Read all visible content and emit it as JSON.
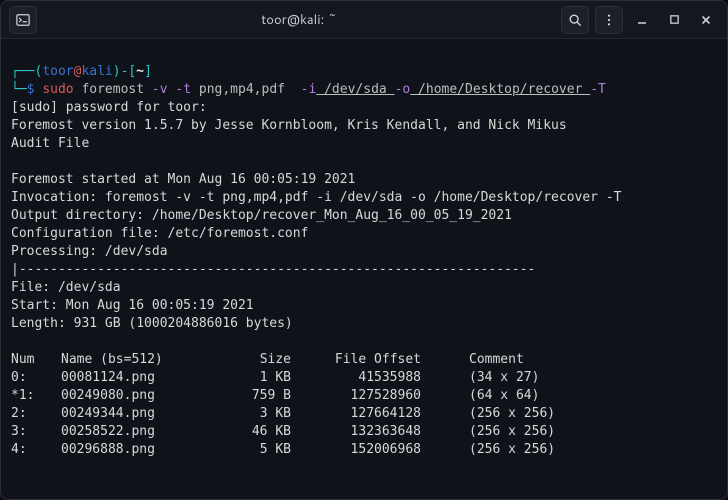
{
  "titlebar": {
    "title": "toor@kali: ~",
    "icons": {
      "app": "terminal-icon",
      "search": "search-icon",
      "menu": "kebab-menu-icon",
      "minimize": "minimize-icon",
      "maximize": "maximize-icon",
      "close": "close-icon"
    }
  },
  "prompt": {
    "open_paren": "┌──(",
    "user": "toor",
    "at": "@",
    "host": "kali",
    "close_paren": ")-[",
    "cwd": "~",
    "close_bracket": "]",
    "line2_prefix": "└─",
    "sigil": "$ ",
    "command_sudo": "sudo",
    "command_rest_1": " foremost ",
    "flag_v": "-v",
    "flag_t": " -t",
    "types": " png,mp4,pdf  ",
    "flag_i": "-i",
    "dev": " /dev/sda ",
    "flag_o": "-o",
    "out": " /home/Desktop/recover ",
    "flag_T": "-T"
  },
  "output": {
    "sudo_prompt": "[sudo] password for toor:",
    "version": "Foremost version 1.5.7 by Jesse Kornbloom, Kris Kendall, and Nick Mikus",
    "audit": "Audit File",
    "blank": "",
    "started": "Foremost started at Mon Aug 16 00:05:19 2021",
    "invocation": "Invocation: foremost -v -t png,mp4,pdf -i /dev/sda -o /home/Desktop/recover -T",
    "outdir": "Output directory: /home/Desktop/recover_Mon_Aug_16_00_05_19_2021",
    "conf": "Configuration file: /etc/foremost.conf",
    "processing": "Processing: /dev/sda",
    "sep": "|------------------------------------------------------------------",
    "file": "File: /dev/sda",
    "start": "Start: Mon Aug 16 00:05:19 2021",
    "length": "Length: 931 GB (1000204886016 bytes)"
  },
  "table": {
    "headers": {
      "num": "Num",
      "name": "Name (bs=512)",
      "size": "Size",
      "offset": "File Offset",
      "comment": "Comment"
    },
    "rows": [
      {
        "num": "0:",
        "name": "00081124.png",
        "size": "1 KB",
        "offset": "41535988",
        "comment": "(34 x 27)"
      },
      {
        "num": "*1:",
        "name": "00249080.png",
        "size": "759 B",
        "offset": "127528960",
        "comment": "(64 x 64)"
      },
      {
        "num": "2:",
        "name": "00249344.png",
        "size": "3 KB",
        "offset": "127664128",
        "comment": "(256 x 256)"
      },
      {
        "num": "3:",
        "name": "00258522.png",
        "size": "46 KB",
        "offset": "132363648",
        "comment": "(256 x 256)"
      },
      {
        "num": "4:",
        "name": "00296888.png",
        "size": "5 KB",
        "offset": "152006968",
        "comment": "(256 x 256)"
      }
    ]
  }
}
